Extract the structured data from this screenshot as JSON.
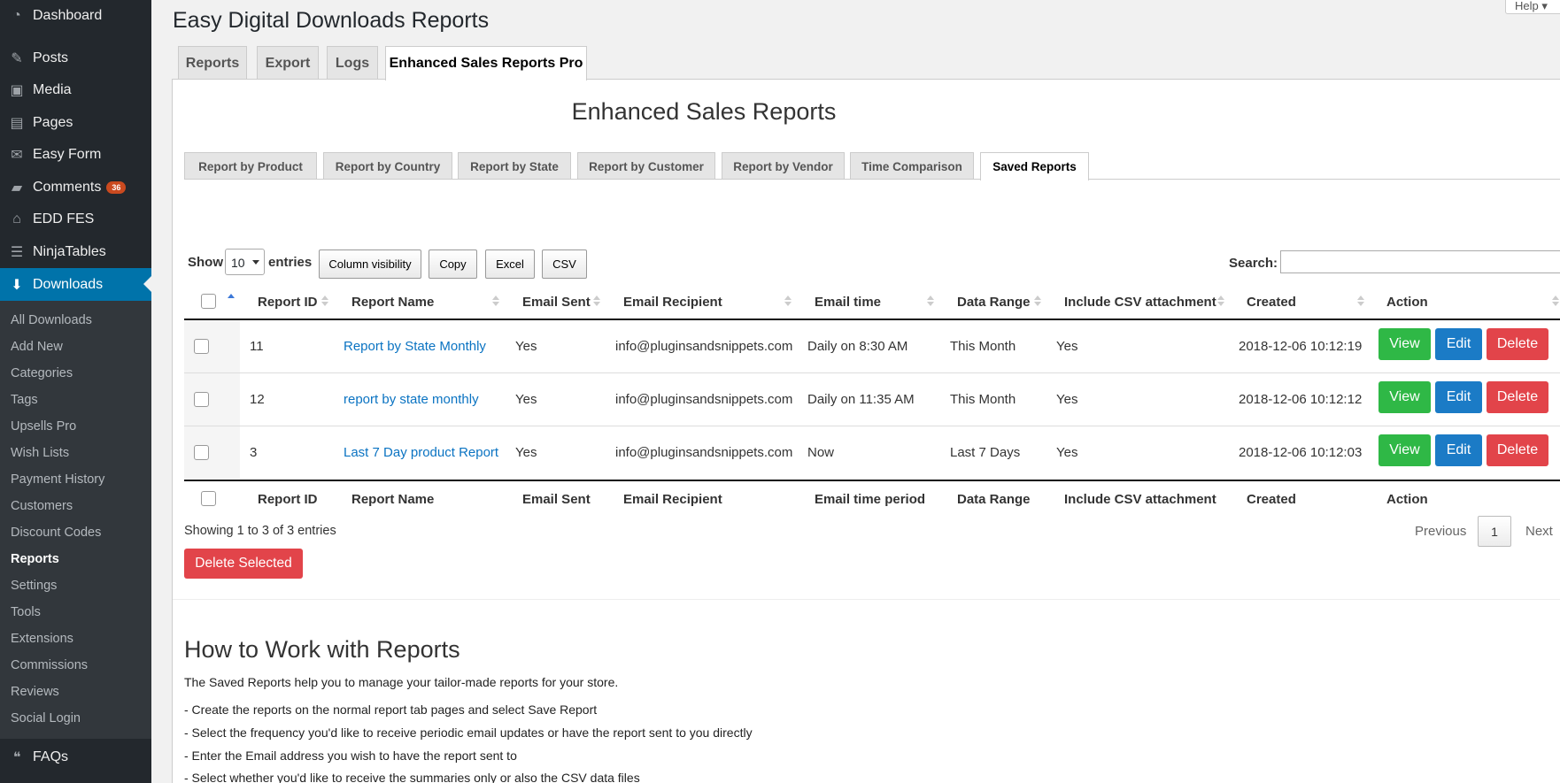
{
  "sidebar": {
    "items": [
      {
        "label": "Dashboard",
        "icon": "dashboard-icon"
      },
      {
        "label": "Posts",
        "icon": "pin-icon"
      },
      {
        "label": "Media",
        "icon": "media-icon"
      },
      {
        "label": "Pages",
        "icon": "pages-icon"
      },
      {
        "label": "Easy Form",
        "icon": "envelope-icon"
      },
      {
        "label": "Comments",
        "icon": "comment-icon",
        "badge": "36"
      },
      {
        "label": "EDD FES",
        "icon": "store-icon"
      },
      {
        "label": "NinjaTables",
        "icon": "table-icon"
      },
      {
        "label": "Downloads",
        "icon": "download-icon"
      }
    ],
    "submenu": [
      "All Downloads",
      "Add New",
      "Categories",
      "Tags",
      "Upsells Pro",
      "Wish Lists",
      "Payment History",
      "Customers",
      "Discount Codes",
      "Reports",
      "Settings",
      "Tools",
      "Extensions",
      "Commissions",
      "Reviews",
      "Social Login"
    ],
    "current_submenu": "Reports",
    "faqs": {
      "label": "FAQs",
      "icon": "faq-icon"
    },
    "active_color": "#0073aa",
    "badge_color": "#ca4a1f"
  },
  "page": {
    "title": "Easy Digital Downloads Reports",
    "help": "Help"
  },
  "tabs": [
    "Reports",
    "Export",
    "Logs",
    "Enhanced Sales Reports Pro"
  ],
  "active_tab": "Enhanced Sales Reports Pro",
  "panel": {
    "title": "Enhanced Sales Reports",
    "subtabs": [
      "Report by Product",
      "Report by Country",
      "Report by State",
      "Report by Customer",
      "Report by Vendor",
      "Time Comparison",
      "Saved Reports"
    ],
    "active_subtab": "Saved Reports"
  },
  "table_controls": {
    "show_label": "Show",
    "length_value": "10",
    "entries_label": "entries",
    "buttons": [
      "Column visibility",
      "Copy",
      "Excel",
      "CSV"
    ],
    "search_label": "Search:",
    "search_value": ""
  },
  "table": {
    "headers": [
      "Report ID",
      "Report Name",
      "Email Sent",
      "Email Recipient",
      "Email time",
      "Data Range",
      "Include CSV attachment",
      "Created",
      "Action"
    ],
    "footer_headers": [
      "Report ID",
      "Report Name",
      "Email Sent",
      "Email Recipient",
      "Email time period",
      "Data Range",
      "Include CSV attachment",
      "Created",
      "Action"
    ],
    "rows": [
      {
        "id": "11",
        "name": "Report by State Monthly",
        "email_sent": "Yes",
        "recipient": "info@pluginsandsnippets.com",
        "email_time": "Daily on 8:30 AM",
        "data_range": "This Month",
        "csv": "Yes",
        "created": "2018-12-06 10:12:19"
      },
      {
        "id": "12",
        "name": "report by state monthly",
        "email_sent": "Yes",
        "recipient": "info@pluginsandsnippets.com",
        "email_time": "Daily on 11:35 AM",
        "data_range": "This Month",
        "csv": "Yes",
        "created": "2018-12-06 10:12:12"
      },
      {
        "id": "3",
        "name": "Last 7 Day product Report",
        "email_sent": "Yes",
        "recipient": "info@pluginsandsnippets.com",
        "email_time": "Now",
        "data_range": "Last 7 Days",
        "csv": "Yes",
        "created": "2018-12-06 10:12:03"
      }
    ],
    "action_labels": {
      "view": "View",
      "edit": "Edit",
      "delete": "Delete"
    },
    "action_colors": {
      "view": "#2fb846",
      "edit": "#1b7bc6",
      "delete": "#e2444a"
    }
  },
  "pagination": {
    "info": "Showing 1 to 3 of 3 entries",
    "previous": "Previous",
    "page": "1",
    "next": "Next"
  },
  "delete_selected": "Delete Selected",
  "help_section": {
    "title": "How to Work with Reports",
    "intro": "The Saved Reports help you to manage your tailor-made reports for your store.",
    "steps": [
      "- Create the reports on the normal report tab pages and select Save Report",
      "- Select the frequency you'd like to receive periodic email updates or have the report sent to you directly",
      "- Enter the Email address you wish to have the report sent to",
      "- Select whether you'd like to receive the summaries only or also the CSV data files"
    ]
  }
}
